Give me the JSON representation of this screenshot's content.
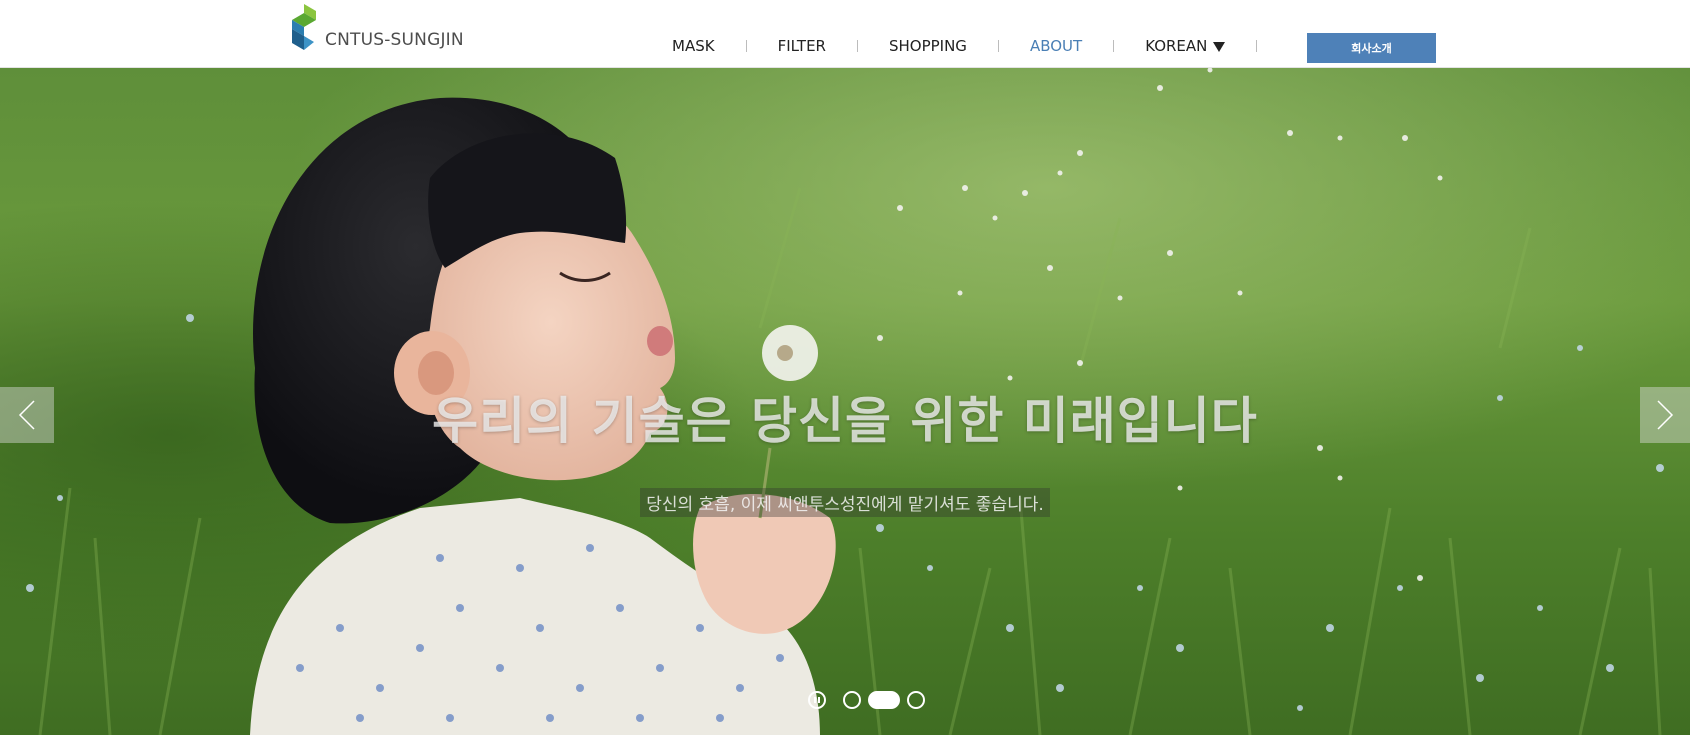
{
  "header": {
    "logo_text": "CNTUS-SUNGJIN",
    "nav": [
      {
        "label": "MASK",
        "active": false
      },
      {
        "label": "FILTER",
        "active": false
      },
      {
        "label": "SHOPPING",
        "active": false
      },
      {
        "label": "ABOUT",
        "active": true
      },
      {
        "label": "KOREAN",
        "active": false,
        "dropdown": true
      }
    ],
    "cta_label": "회사소개"
  },
  "hero": {
    "title": "우리의 기술은 당신을 위한 미래입니다",
    "subtitle": "당신의 호흡, 이제 씨앤투스성진에게 맡기셔도 좋습니다.",
    "prev_icon": "chevron-left-icon",
    "next_icon": "chevron-right-icon",
    "pause_icon": "pause-icon",
    "slides_total": 3,
    "slide_active": 2
  },
  "colors": {
    "accent": "#4e81b8",
    "nav_active": "#4a7fb5",
    "logo_green": "#7cc142",
    "logo_blue": "#2b6fa3"
  }
}
